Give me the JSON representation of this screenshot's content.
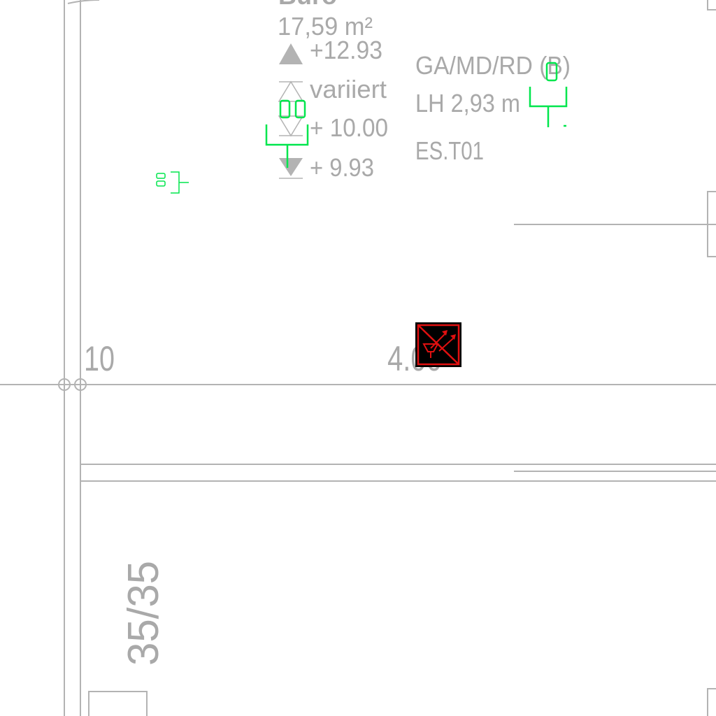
{
  "room": {
    "name": "Büro",
    "area": "17,59 m²",
    "level_top": "+12.93",
    "level_mid_label": "variiert",
    "level_mid": "+ 10.00",
    "level_bottom": "+ 9.93"
  },
  "room_spec": {
    "flooring": "GA/MD/RD (B)",
    "clear_height": "LH 2,93 m",
    "code": "ES.T01"
  },
  "dimensions": {
    "left_value": "10",
    "center_value": "4.00",
    "column_size": "35/35"
  },
  "colors": {
    "line": "#b3b3b3",
    "text": "#a9a9a9",
    "electrical": "#00e64d",
    "marker_fill": "#000000",
    "marker_stroke": "#e01010"
  },
  "icons": {
    "socket_large": "double-socket-icon",
    "socket_small": "double-socket-small-icon",
    "socket_right": "single-socket-icon",
    "marker": "no-signal-warning-icon"
  }
}
